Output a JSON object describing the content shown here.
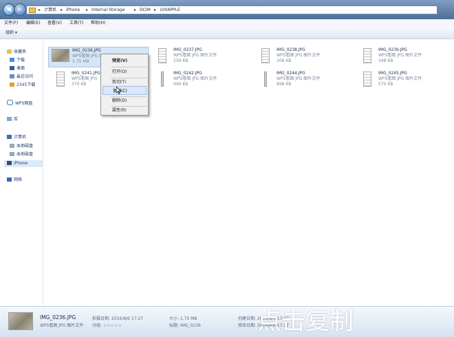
{
  "breadcrumb": [
    "计算机",
    "iPhone",
    "Internal Storage",
    "DCIM",
    "100APPLE"
  ],
  "menubar": [
    "文件(F)",
    "编辑(E)",
    "查看(V)",
    "工具(T)",
    "帮助(H)"
  ],
  "toolbar": {
    "organize": "组织 ▾"
  },
  "nav": {
    "favorites": "收藏夹",
    "downloads": "下载",
    "desktop": "桌面",
    "recent": "最近访问",
    "cloud2345": "2345下载",
    "wps_cloud": "WPS网盘",
    "libraries": "库",
    "computer": "计算机",
    "local_disk_1": "本地磁盘",
    "local_disk_2": "本地磁盘",
    "iphone": "iPhone",
    "network": "网络"
  },
  "files": [
    {
      "name": "IMG_0236.JPG",
      "type": "WPS看图 JPG 图片文件",
      "size": "1.75 MB"
    },
    {
      "name": "IMG_0237.JPG",
      "type": "WPS看图 JPG 图片文件",
      "size": "259 KB"
    },
    {
      "name": "IMG_0238.JPG",
      "type": "WPS看图 JPG 图片文件",
      "size": "208 KB"
    },
    {
      "name": "IMG_0239.JPG",
      "type": "WPS看图 JPG 图片文件",
      "size": "348 KB"
    },
    {
      "name": "IMG_0241.JPG",
      "type": "WPS看图 JPG",
      "size": "370 KB"
    },
    {
      "name": "IMG_0242.JPG",
      "type": "WPS看图 JPG 图片文件",
      "size": "490 KB"
    },
    {
      "name": "IMG_0244.JPG",
      "type": "WPS看图 JPG 图片文件",
      "size": "898 KB"
    },
    {
      "name": "IMG_0245.JPG",
      "type": "WPS看图 JPG 图片文件",
      "size": "570 KB"
    }
  ],
  "context_menu": {
    "preview": "预览(V)",
    "open": "打开(O)",
    "cut": "剪切(T)",
    "copy": "复制(C)",
    "delete": "删除(D)",
    "properties": "属性(R)"
  },
  "details": {
    "name": "IMG_0236.JPG",
    "type": "WPS看图 JPG 图片文件",
    "date_taken": "拍摄日期: 2016/8/6 17:27",
    "rating": "分级: ☆☆☆☆☆",
    "size": "大小: 1.75 MB",
    "title": "标题: IMG_0236",
    "created": "创建日期: 2016/8/6 17:27",
    "modified": "修改日期: 2016/8/6 17:27"
  },
  "caption": "点击复制"
}
